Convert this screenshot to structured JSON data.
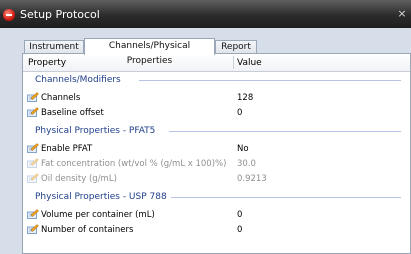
{
  "window": {
    "title": "Setup Protocol",
    "close_glyph": "×"
  },
  "tabs": [
    {
      "label": "Instrument",
      "active": false
    },
    {
      "label": "Channels/Physical Properties",
      "active": true
    },
    {
      "label": "Report",
      "active": false
    }
  ],
  "grid": {
    "header_property": "Property",
    "header_value": "Value"
  },
  "sections": [
    {
      "title": "Channels/Modifiers",
      "rows": [
        {
          "label": "Channels",
          "value": "128",
          "enabled": true,
          "icon": "edit-pencil-icon"
        },
        {
          "label": "Baseline offset",
          "value": "0",
          "enabled": true,
          "icon": "edit-pencil-icon"
        }
      ]
    },
    {
      "title": "Physical Properties - PFAT5",
      "rows": [
        {
          "label": "Enable PFAT",
          "value": "No",
          "enabled": true,
          "icon": "edit-pencil-icon"
        },
        {
          "label": "Fat concentration (wt/vol % (g/mL x 100)%)",
          "value": "30.0",
          "enabled": false,
          "icon": "edit-pencil-icon"
        },
        {
          "label": "Oil density (g/mL)",
          "value": "0.9213",
          "enabled": false,
          "icon": "edit-pencil-icon"
        }
      ]
    },
    {
      "title": "Physical Properties - USP 788",
      "rows": [
        {
          "label": "Volume per container (mL)",
          "value": "0",
          "enabled": true,
          "icon": "edit-pencil-icon"
        },
        {
          "label": "Number of containers",
          "value": "0",
          "enabled": true,
          "icon": "edit-pencil-icon"
        }
      ]
    }
  ],
  "colors": {
    "section_title": "#1f3e8a",
    "disabled_text": "#8f8f8f",
    "title_bar": "#2b2b2b"
  }
}
